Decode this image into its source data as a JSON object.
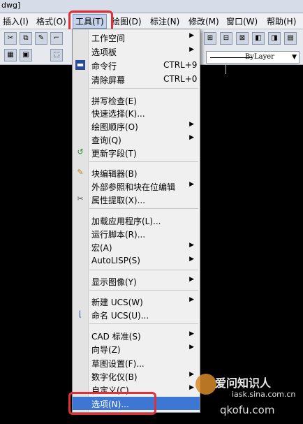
{
  "titlebar": {
    "text": "dwg]"
  },
  "menubar": {
    "items": [
      {
        "label": "插入(I)"
      },
      {
        "label": "格式(O)"
      },
      {
        "label": "工具(T)"
      },
      {
        "label": "绘图(D)"
      },
      {
        "label": "标注(N)"
      },
      {
        "label": "修改(M)"
      },
      {
        "label": "窗口(W)"
      },
      {
        "label": "帮助(H)"
      }
    ]
  },
  "toolbar": {
    "linetype": "ByLayer"
  },
  "tools_menu": {
    "items": [
      {
        "label": "工作空间",
        "submenu": true
      },
      {
        "label": "选项板",
        "submenu": true
      },
      {
        "label": "命令行",
        "shortcut": "CTRL+9",
        "icon": "command-line-icon"
      },
      {
        "label": "清除屏幕",
        "shortcut": "CTRL+0"
      },
      {
        "label": "拼写检查(E)"
      },
      {
        "label": "快速选择(K)..."
      },
      {
        "label": "绘图顺序(O)",
        "submenu": true
      },
      {
        "label": "查询(Q)",
        "submenu": true
      },
      {
        "label": "更新字段(T)",
        "icon": "update-field-icon"
      },
      {
        "label": "块编辑器(B)",
        "icon": "block-editor-icon"
      },
      {
        "label": "外部参照和块在位编辑",
        "submenu": true
      },
      {
        "label": "属性提取(X)...",
        "icon": "attribute-extract-icon"
      },
      {
        "label": "加载应用程序(L)..."
      },
      {
        "label": "运行脚本(R)..."
      },
      {
        "label": "宏(A)",
        "submenu": true
      },
      {
        "label": "AutoLISP(S)",
        "submenu": true
      },
      {
        "label": "显示图像(Y)",
        "submenu": true
      },
      {
        "label": "新建 UCS(W)",
        "submenu": true
      },
      {
        "label": "命名 UCS(U)...",
        "icon": "named-ucs-icon"
      },
      {
        "label": "CAD 标准(S)",
        "submenu": true
      },
      {
        "label": "向导(Z)",
        "submenu": true
      },
      {
        "label": "草图设置(F)..."
      },
      {
        "label": "数字化仪(B)",
        "submenu": true
      },
      {
        "label": "自定义(C)",
        "submenu": true
      },
      {
        "label": "选项(N)...",
        "selected": true
      }
    ]
  },
  "watermark": {
    "line1": "爱问知识人",
    "line2": "iask.sina.com.cn",
    "line3": "qkofu.com"
  },
  "colors": {
    "highlight_box": "#e0303a",
    "selected_item": "#3e76d4",
    "canvas": "#000000"
  }
}
